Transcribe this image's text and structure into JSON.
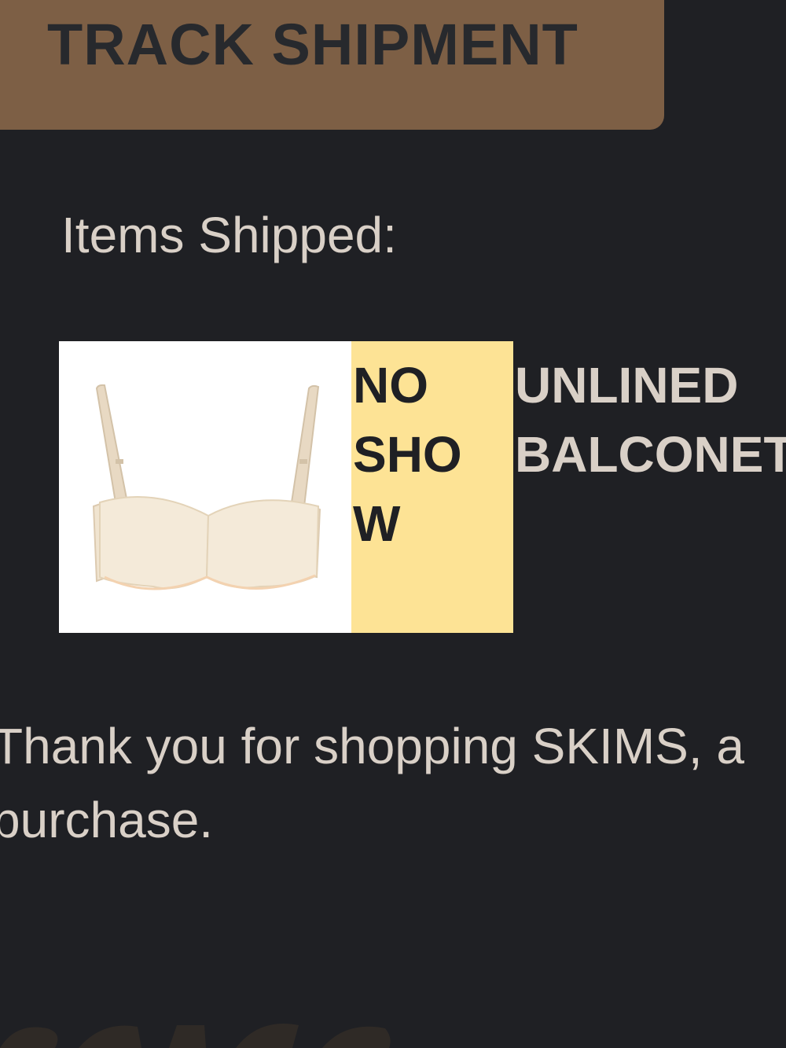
{
  "track_button": {
    "label": "TRACK SHIPMENT"
  },
  "items_heading": "Items Shipped:",
  "item": {
    "size_label": "NO SHOW",
    "size_lines": [
      "NO",
      "SHO",
      "W"
    ],
    "name_lines": [
      "UNLINED",
      "BALCONETTE"
    ],
    "image_alt": "bra-product-image"
  },
  "thank_you": {
    "line1": "Thank you for shopping SKIMS, a",
    "line2": "purchase."
  },
  "colors": {
    "background": "#1f2024",
    "button": "#7d5f45",
    "badge": "#fde395",
    "text": "#d9d0c7"
  }
}
